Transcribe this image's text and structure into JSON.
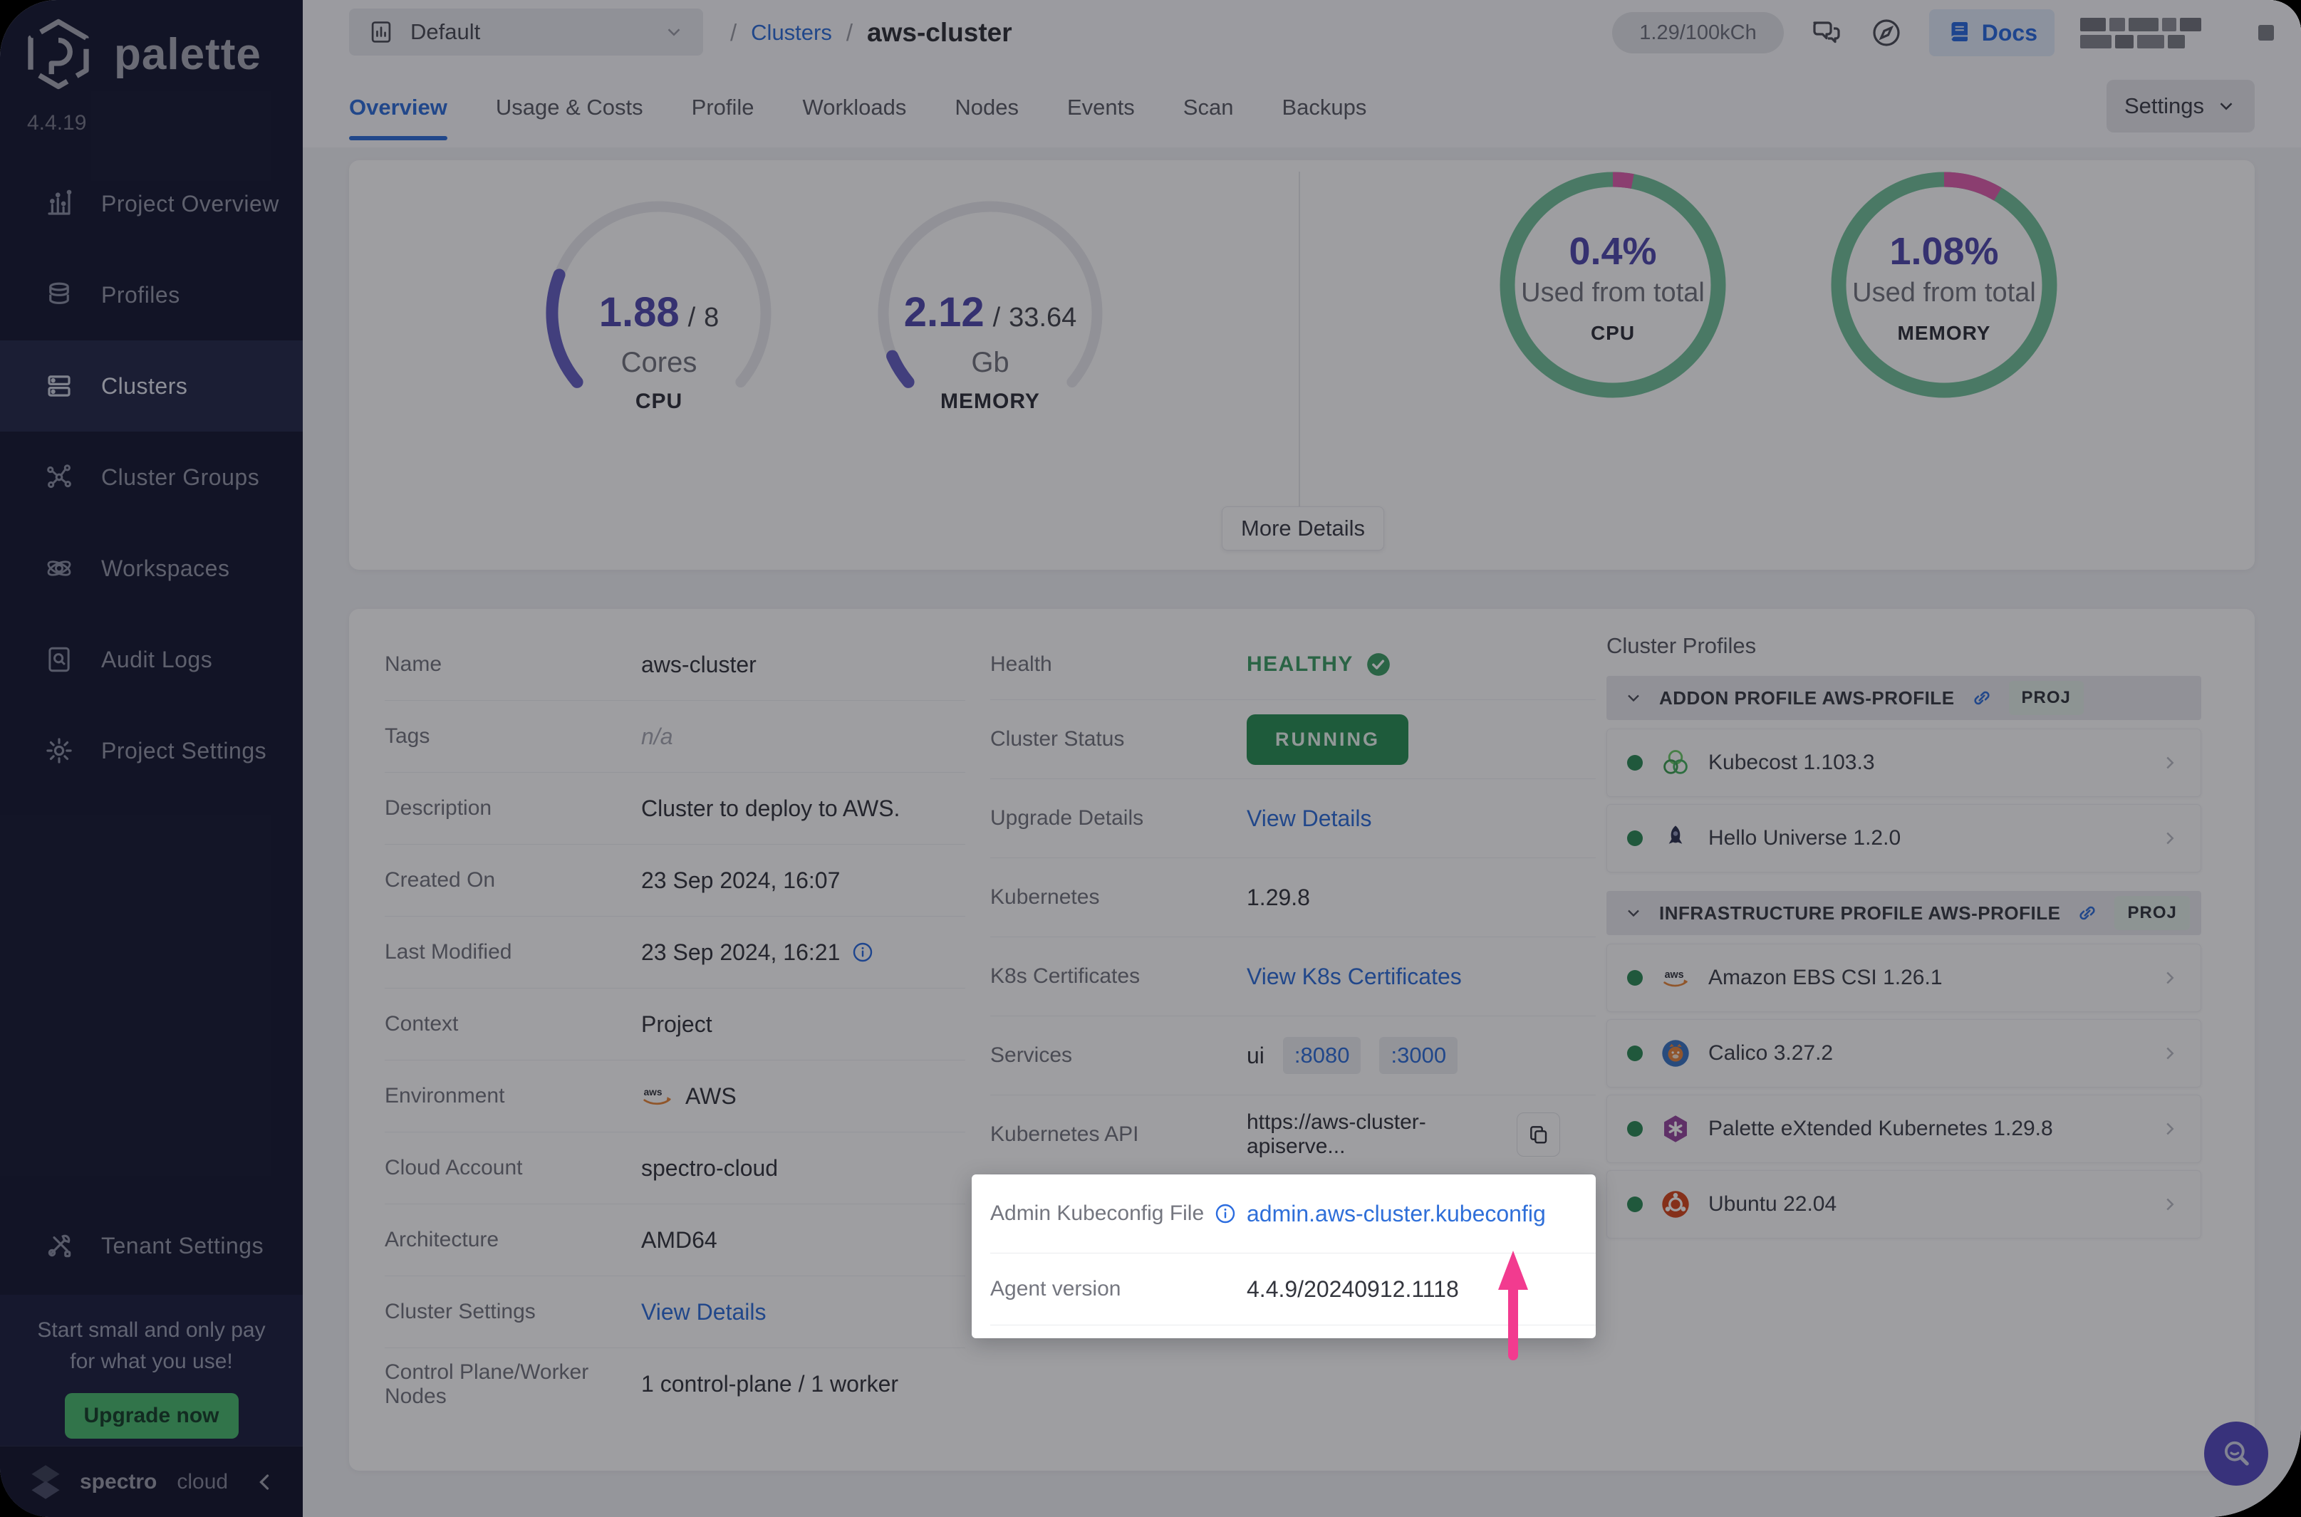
{
  "colors": {
    "accent_blue": "#2f6fd9",
    "status_green": "#3f9e66",
    "running_badge_green": "#2a9055",
    "gauge_purple": "#504aad",
    "ring_green": "#74c29b",
    "ring_pink": "#e05fae",
    "arrow_pink": "#f23b8f",
    "upgrade_green": "#4aba6e"
  },
  "sidebar": {
    "brand": "palette",
    "version": "4.4.19",
    "items": [
      {
        "label": "Project Overview"
      },
      {
        "label": "Profiles"
      },
      {
        "label": "Clusters"
      },
      {
        "label": "Cluster Groups"
      },
      {
        "label": "Workspaces"
      },
      {
        "label": "Audit Logs"
      },
      {
        "label": "Project Settings"
      }
    ],
    "tenant_settings": "Tenant Settings",
    "upsell_line1": "Start small and only pay",
    "upsell_line2": "for what you use!",
    "upgrade_cta": "Upgrade now",
    "footer_brand_bold": "spectro",
    "footer_brand_light": "cloud"
  },
  "topbar": {
    "project_selector": "Default",
    "breadcrumb_sep": "/",
    "breadcrumb_parent": "Clusters",
    "breadcrumb_current": "aws-cluster",
    "usage_pill": "1.29/100kCh",
    "docs_label": "Docs"
  },
  "tabs": {
    "items": [
      "Overview",
      "Usage & Costs",
      "Profile",
      "Workloads",
      "Nodes",
      "Events",
      "Scan",
      "Backups"
    ],
    "active": "Overview",
    "settings_label": "Settings"
  },
  "metrics": {
    "cpu_gauge": {
      "value": "1.88",
      "sep": "/",
      "total": "8",
      "unit": "Cores",
      "label": "CPU",
      "fraction": 0.235
    },
    "memory_gauge": {
      "value": "2.12",
      "sep": "/",
      "total": "33.64",
      "unit": "Gb",
      "label": "MEMORY",
      "fraction": 0.063
    },
    "cpu_ring": {
      "percent": "0.4%",
      "caption": "Used from total",
      "label": "CPU",
      "fraction": 0.03
    },
    "memory_ring": {
      "percent": "1.08%",
      "caption": "Used from total",
      "label": "MEMORY",
      "fraction": 0.085
    },
    "more_details_label": "More Details"
  },
  "details": {
    "name": {
      "label": "Name",
      "value": "aws-cluster"
    },
    "tags": {
      "label": "Tags",
      "value": "n/a"
    },
    "description": {
      "label": "Description",
      "value": "Cluster to deploy to AWS."
    },
    "created_on": {
      "label": "Created On",
      "value": "23 Sep 2024, 16:07"
    },
    "last_modified": {
      "label": "Last Modified",
      "value": "23 Sep 2024, 16:21"
    },
    "context": {
      "label": "Context",
      "value": "Project"
    },
    "environment": {
      "label": "Environment",
      "value": "AWS"
    },
    "cloud_account": {
      "label": "Cloud Account",
      "value": "spectro-cloud"
    },
    "architecture": {
      "label": "Architecture",
      "value": "AMD64"
    },
    "cluster_settings": {
      "label": "Cluster Settings",
      "value": "View Details"
    },
    "nodes": {
      "label": "Control Plane/Worker Nodes",
      "value": "1 control-plane / 1 worker"
    }
  },
  "status": {
    "health": {
      "label": "Health",
      "value": "HEALTHY"
    },
    "cluster_status": {
      "label": "Cluster Status",
      "value": "RUNNING"
    },
    "upgrade": {
      "label": "Upgrade Details",
      "value": "View Details"
    },
    "kubernetes": {
      "label": "Kubernetes",
      "value": "1.29.8"
    },
    "certs": {
      "label": "K8s Certificates",
      "value": "View K8s Certificates"
    },
    "services": {
      "label": "Services",
      "name": "ui",
      "port1": ":8080",
      "port2": ":3000"
    },
    "api": {
      "label": "Kubernetes API",
      "value": "https://aws-cluster-apiserve..."
    },
    "kubeconfig": {
      "label": "Admin Kubeconfig File",
      "value": "admin.aws-cluster.kubeconfig"
    },
    "agent": {
      "label": "Agent version",
      "value": "4.4.9/20240912.1118"
    }
  },
  "profiles": {
    "title": "Cluster Profiles",
    "group1": {
      "name": "ADDON PROFILE AWS-PROFILE",
      "badge": "PROJ",
      "item1": "Kubecost 1.103.3",
      "item2": "Hello Universe 1.2.0"
    },
    "group2": {
      "name": "INFRASTRUCTURE PROFILE AWS-PROFILE",
      "badge": "PROJ",
      "item1": "Amazon EBS CSI 1.26.1",
      "item2": "Calico 3.27.2",
      "item3": "Palette eXtended Kubernetes 1.29.8",
      "item4": "Ubuntu 22.04"
    }
  }
}
